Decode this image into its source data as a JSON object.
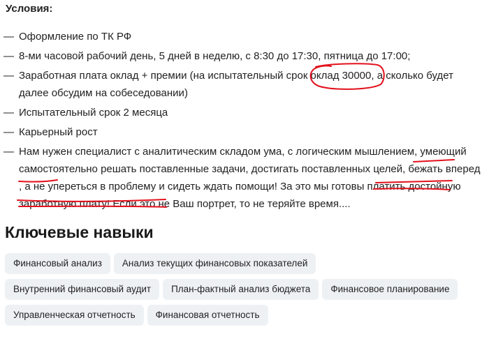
{
  "conditions": {
    "title": "Условия:",
    "dash": "—",
    "items": [
      "Оформление по ТК РФ",
      "8-ми часовой рабочий день, 5 дней в неделю, с 8:30 до 17:30, пятница до 17:00;",
      "Заработная плата оклад + премии (на испытательный срок оклад 30000, а сколько будет далее обсудим на собеседовании)",
      "Испытательный срок 2 месяца",
      "Карьерный рост",
      "Нам нужен специалист с аналитическим складом ума, с логическим мышлением, умеющий самостоятельно решать поставленные задачи, достигать поставленных целей, бежать вперед , а не упереться в проблему и сидеть ждать помощи! За это мы готовы платить достойную заработную плату! Если это не Ваш портрет, то не теряйте время...."
    ]
  },
  "skills": {
    "title": "Ключевые навыки",
    "tags": [
      "Финансовый анализ",
      "Анализ текущих финансовых показателей",
      "Внутренний финансовый аудит",
      "План-фактный анализ бюджета",
      "Финансовое планирование",
      "Управленческая отчетность",
      "Финансовая отчетность"
    ]
  },
  "annotation_color": "#e3101b"
}
